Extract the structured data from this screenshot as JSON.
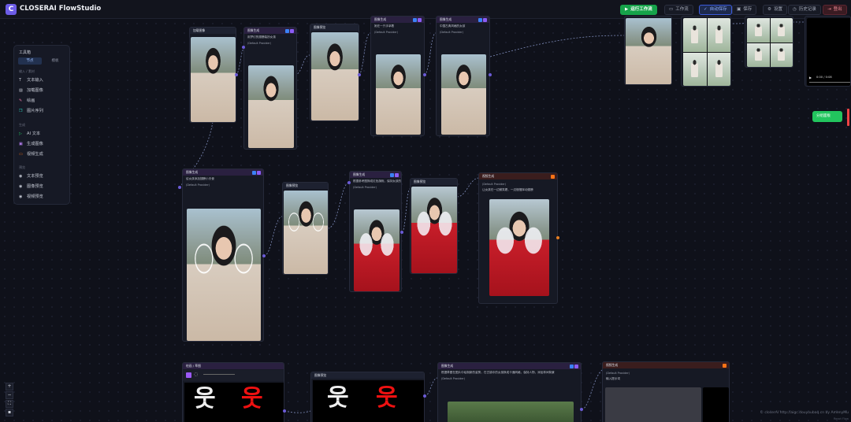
{
  "app": {
    "logo_letter": "C",
    "title": "CLOSERAI FlowStudio"
  },
  "toolbar": {
    "run": "运行工作流",
    "workflow": "工作流",
    "auto_save": "自动保存",
    "save": "保存",
    "settings": "设置",
    "history": "历史记录",
    "logout": "登出"
  },
  "palette": {
    "title": "工具箱",
    "tabs": [
      "节点",
      "模板"
    ],
    "sections": [
      {
        "label": "输入 / 素材",
        "items": [
          "文本输入",
          "加载图像",
          "绘画",
          "图片序列"
        ]
      },
      {
        "label": "生成",
        "items": [
          "AI 文本",
          "生成图像",
          "视频生成"
        ]
      },
      {
        "label": "预览",
        "items": [
          "文本预览",
          "图像预览",
          "视频预览"
        ]
      }
    ]
  },
  "nodes": {
    "load_image": "加载图像",
    "image_gen": "图像生成",
    "image_preview": "图像预览",
    "video_gen": "视频生成",
    "draw": "绘画 / 草图",
    "provider": "(Default Provider)",
    "model": "(Default Model)",
    "prompt_1": "用梦幻的翅膀装扮女孩",
    "prompt_2": "她在一只手拿着",
    "prompt_3": "中国古典风格的女孩",
    "prompt_4": "给女孩添加翅膀小天使",
    "prompt_5": "根据参考图换成红色旗袍，保持女孩的姿势",
    "prompt_6": "让女孩在一边微笑着，一边慢慢挥动翅膀",
    "prompt_7": "根据草图在图片中绘制新的姿势，在古镇中的女孩换成卡通风格，保持人物，添加林间背景",
    "prompt_8": "输入提示词",
    "video_time": "0:00 / 0:08",
    "float_label": "分组面板"
  },
  "footer": {
    "credit": "© closerAI  http://aigc.douyoubaq.cn by AmenyMu",
    "react_flow": "React Flow"
  },
  "colors": {
    "accent": "#6c5ce7",
    "run": "#16a34a",
    "handle": "#6b5bd6"
  }
}
